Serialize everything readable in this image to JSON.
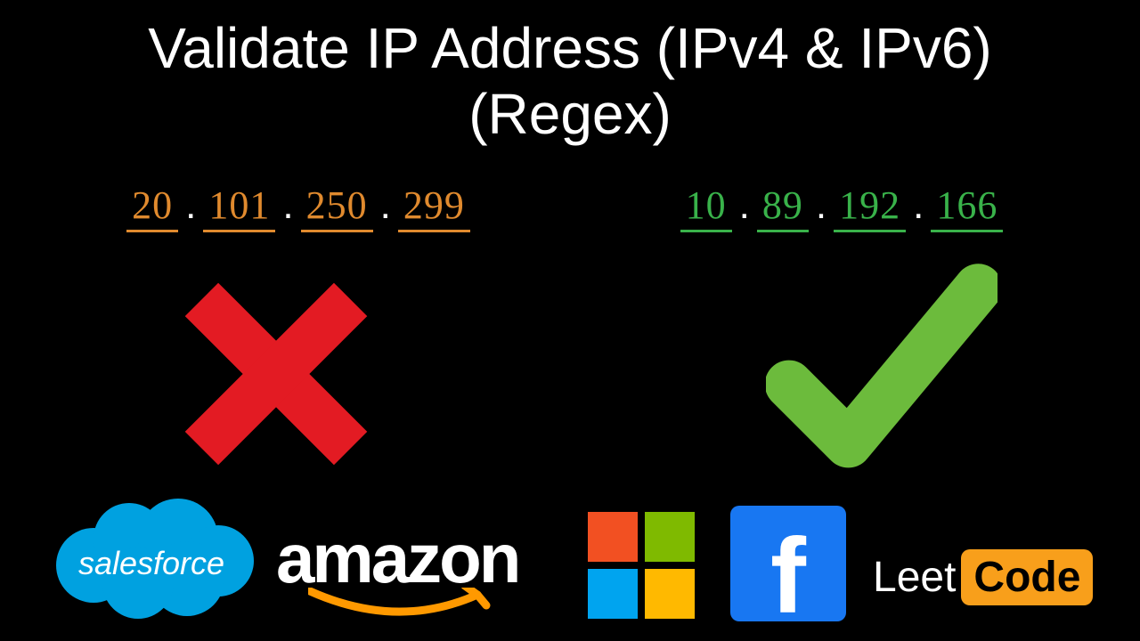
{
  "title_line1": "Validate IP Address (IPv4 & IPv6)",
  "title_line2": "(Regex)",
  "invalid_ip": {
    "o1": "20",
    "o2": "101",
    "o3": "250",
    "o4": "299"
  },
  "valid_ip": {
    "o1": "10",
    "o2": "89",
    "o3": "192",
    "o4": "166"
  },
  "logos": {
    "salesforce": "salesforce",
    "amazon": "amazon",
    "leetcode_leet": "Leet",
    "leetcode_code": "Code",
    "facebook_letter": "f"
  },
  "colors": {
    "invalid": "#e08a2e",
    "valid": "#39b24a",
    "cross": "#e31b23",
    "check": "#6cbb3c"
  }
}
